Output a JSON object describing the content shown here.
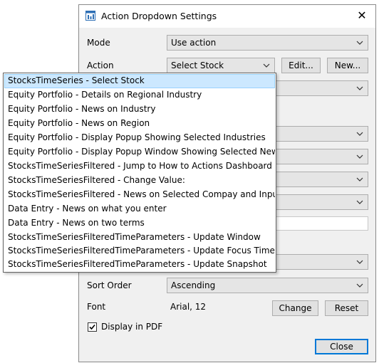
{
  "window": {
    "title": "Action Dropdown Settings",
    "close_glyph": "✕",
    "icon": "app-window-icon"
  },
  "form": {
    "mode_label": "Mode",
    "mode_value": "Use action",
    "action_label": "Action",
    "action_value": "Select Stock",
    "edit_button": "Edit...",
    "new_button": "New...",
    "sort_order_label": "Sort Order",
    "sort_order_value": "Ascending",
    "font_label": "Font",
    "font_value": "Arial, 12",
    "change_button": "Change",
    "reset_button": "Reset",
    "display_pdf_label": "Display in PDF",
    "display_pdf_checked": true,
    "close_button": "Close"
  },
  "dropdown": {
    "selected_index": 0,
    "items": [
      "StocksTimeSeries - Select Stock",
      "Equity Portfolio - Details on Regional Industry",
      "Equity Portfolio - News on Industry",
      "Equity Portfolio - News on Region",
      "Equity Portfolio - Display Popup Showing Selected Industries",
      "Equity Portfolio - Display Popup Window Showing Selected News",
      "StocksTimeSeriesFiltered - Jump to How to Actions Dashboard",
      "StocksTimeSeriesFiltered - Change Value:",
      "StocksTimeSeriesFiltered - News on Selected Compay and Input Phase",
      "Data Entry - News on what you enter",
      "Data Entry - News on two terms",
      "StocksTimeSeriesFilteredTimeParameters - Update Window",
      "StocksTimeSeriesFilteredTimeParameters - Update Focus Time",
      "StocksTimeSeriesFilteredTimeParameters - Update Snapshot"
    ]
  },
  "colors": {
    "selection": "#cce8ff",
    "selection_border": "#99d1ff",
    "accent": "#0078d7",
    "dialog_bg": "#f0f0f0"
  }
}
